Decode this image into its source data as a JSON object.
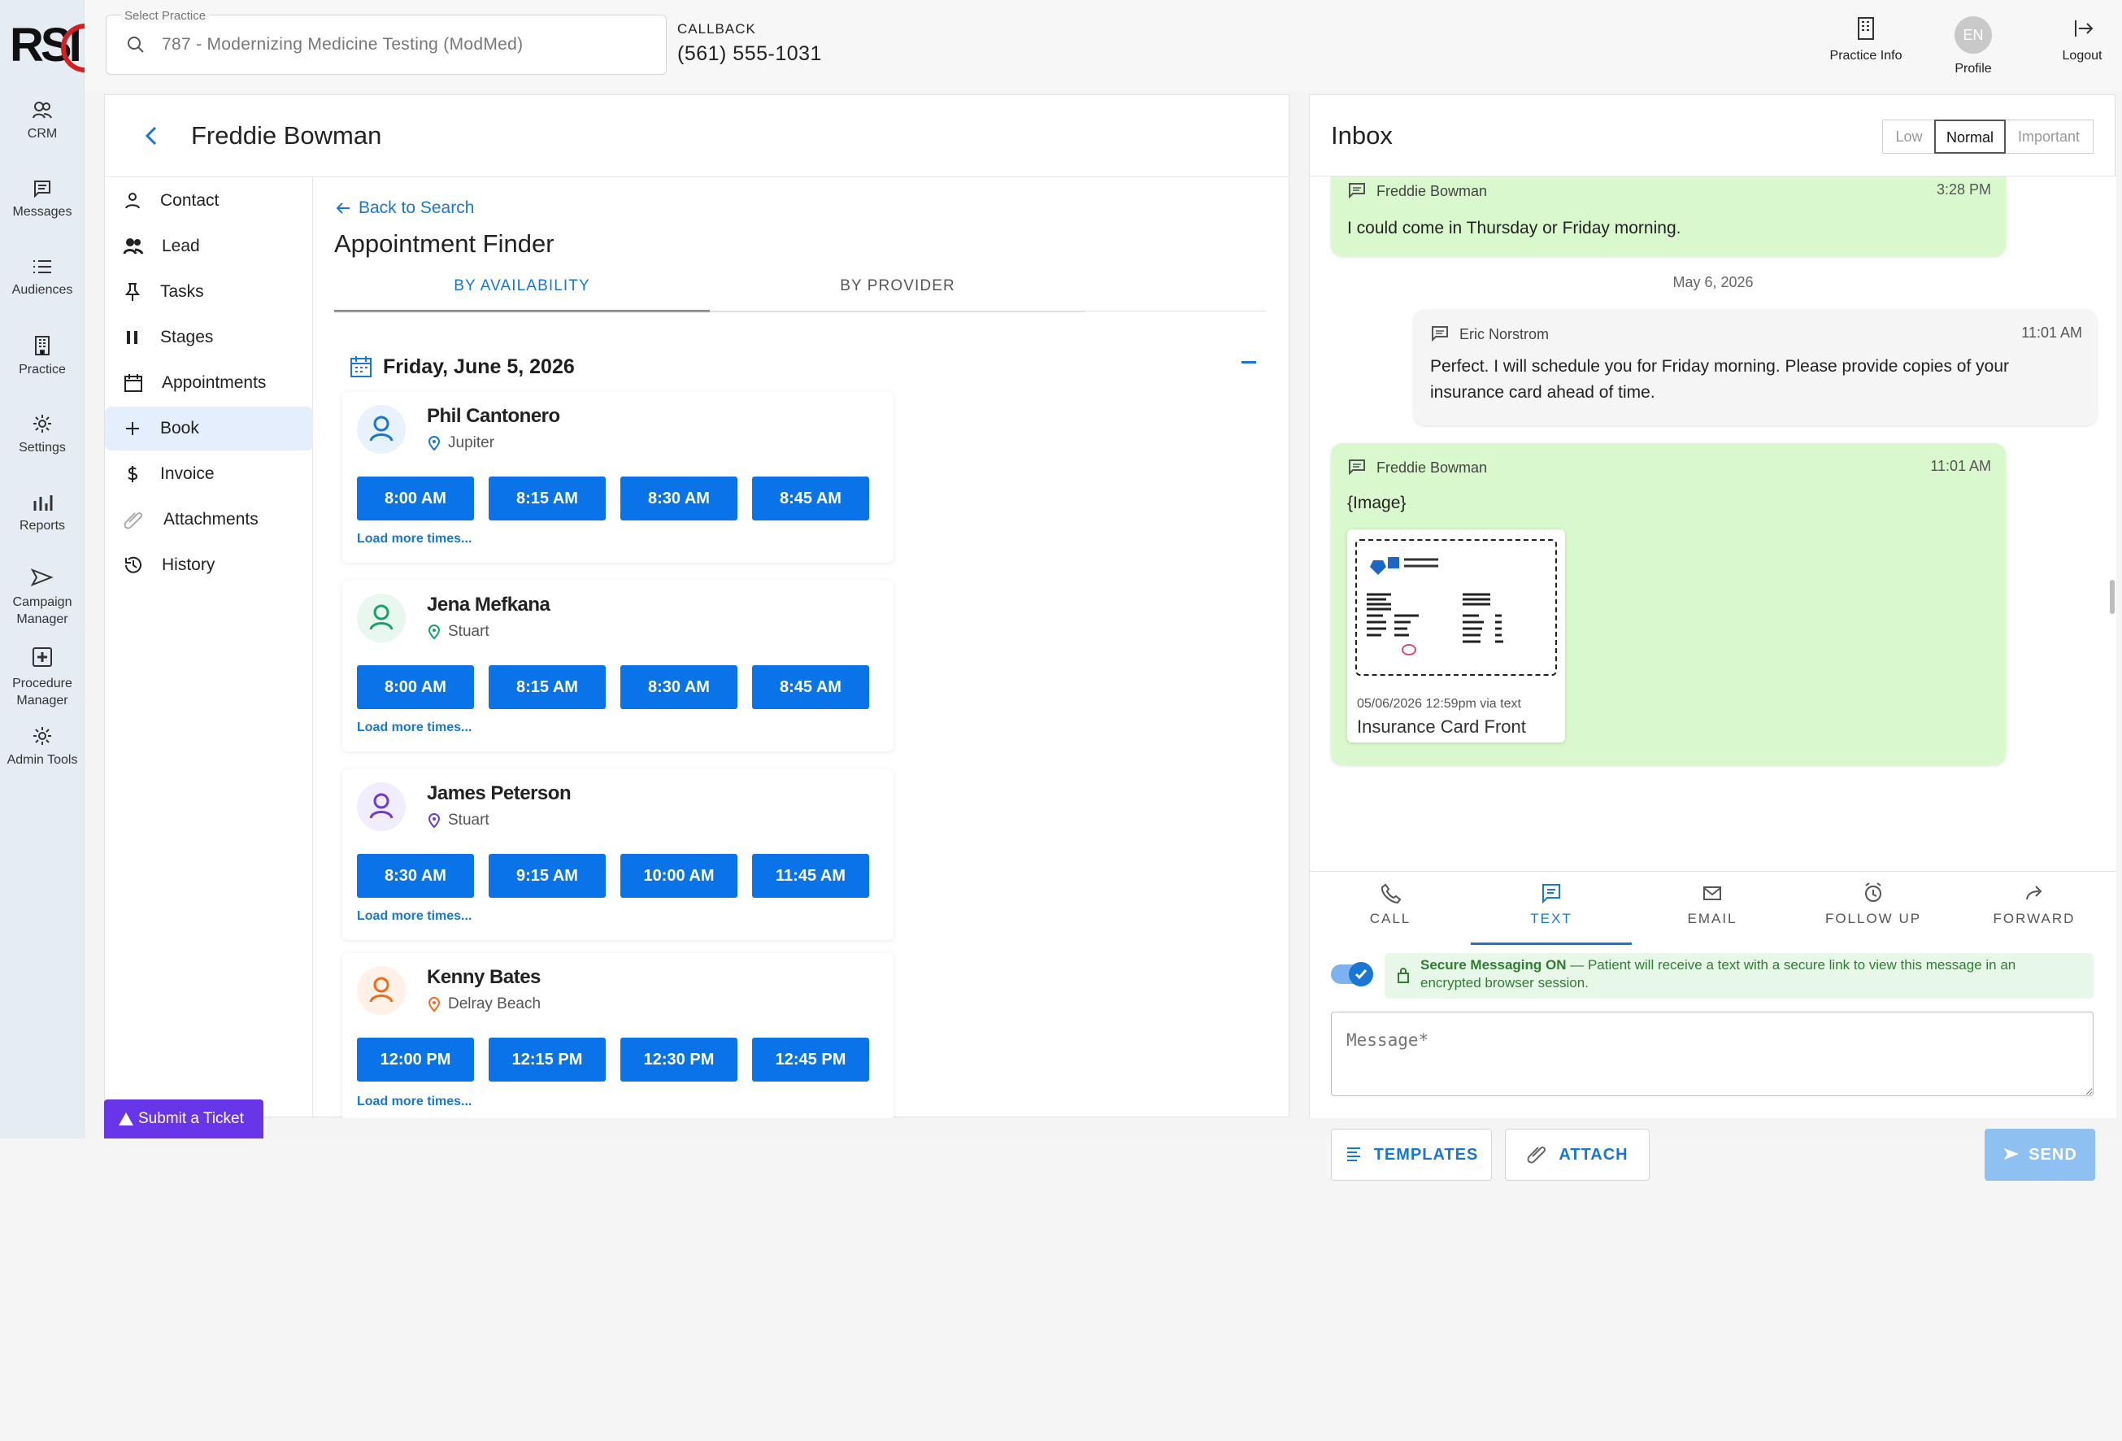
{
  "brand": {
    "logo_text": "RSI"
  },
  "rail": [
    {
      "label": "CRM",
      "icon": "users-icon"
    },
    {
      "label": "Messages",
      "icon": "message-icon"
    },
    {
      "label": "Audiences",
      "icon": "list-icon"
    },
    {
      "label": "Practice",
      "icon": "building-icon"
    },
    {
      "label": "Settings",
      "icon": "gear-icon"
    },
    {
      "label": "Reports",
      "icon": "bar-chart-icon"
    },
    {
      "label": "Campaign\nManager",
      "icon": "send-icon"
    },
    {
      "label": "Procedure\nManager",
      "icon": "plus-square-icon"
    },
    {
      "label": "Admin Tools",
      "icon": "gear-icon"
    }
  ],
  "topbar": {
    "practice_label": "Select Practice",
    "practice_value": "787 - Modernizing Medicine Testing (ModMed)",
    "callback_label": "CALLBACK",
    "callback_phone": "(561) 555-1031",
    "practice_info": "Practice Info",
    "profile": "Profile",
    "profile_initials": "EN",
    "logout": "Logout"
  },
  "patient": {
    "name": "Freddie Bowman"
  },
  "sidebar": {
    "items": [
      {
        "label": "Contact",
        "icon": "person-icon"
      },
      {
        "label": "Lead",
        "icon": "users-icon"
      },
      {
        "label": "Tasks",
        "icon": "pin-icon"
      },
      {
        "label": "Stages",
        "icon": "pause-icon"
      },
      {
        "label": "Appointments",
        "icon": "calendar-icon"
      },
      {
        "label": "Book",
        "icon": "plus-icon"
      },
      {
        "label": "Invoice",
        "icon": "dollar-icon"
      },
      {
        "label": "Attachments",
        "icon": "paperclip-icon"
      },
      {
        "label": "History",
        "icon": "history-icon"
      }
    ]
  },
  "finder": {
    "back_label": "Back to Search",
    "title": "Appointment Finder",
    "tabs": [
      "BY AVAILABILITY",
      "BY PROVIDER"
    ],
    "date": "Friday, June 5, 2026",
    "providers": [
      {
        "name": "Phil Cantonero",
        "location": "Jupiter",
        "color": "#1976d2",
        "times": [
          "8:00 AM",
          "8:15 AM",
          "8:30 AM",
          "8:45 AM"
        ],
        "load_more": "Load more times..."
      },
      {
        "name": "Jena Mefkana",
        "location": "Stuart",
        "color": "#16a36a",
        "times": [
          "8:00 AM",
          "8:15 AM",
          "8:30 AM",
          "8:45 AM"
        ],
        "load_more": "Load more times..."
      },
      {
        "name": "James Peterson",
        "location": "Stuart",
        "color": "#6b3bd2",
        "times": [
          "8:30 AM",
          "9:15 AM",
          "10:00 AM",
          "11:45 AM"
        ],
        "load_more": "Load more times..."
      },
      {
        "name": "Kenny Bates",
        "location": "Delray Beach",
        "color": "#ef6c1a",
        "times": [
          "12:00 PM",
          "12:15 PM",
          "12:30 PM",
          "12:45 PM"
        ],
        "load_more": "Load more times..."
      }
    ]
  },
  "inbox": {
    "title": "Inbox",
    "priority": [
      "Low",
      "Normal",
      "Important"
    ],
    "messages": [
      {
        "sender": "Freddie Bowman",
        "time": "3:28 PM",
        "text": "I could come in Thursday or Friday morning."
      },
      {
        "date": "May 6, 2026"
      },
      {
        "sender": "Eric Norstrom",
        "time": "11:01 AM",
        "text": "Perfect. I will schedule you for Friday morning. Please provide copies of your insurance card ahead of time."
      },
      {
        "sender": "Freddie Bowman",
        "time": "11:01 AM",
        "text": "{Image}"
      }
    ],
    "attachment": {
      "meta": "05/06/2026 12:59pm via text",
      "name": "Insurance Card Front"
    }
  },
  "composer": {
    "tabs": [
      "CALL",
      "TEXT",
      "EMAIL",
      "FOLLOW UP",
      "FORWARD"
    ],
    "secure_title": "Secure Messaging ON",
    "secure_text": " — Patient will receive a text with a secure link to view this message in an encrypted browser session.",
    "message_placeholder": "Message*",
    "templates": "TEMPLATES",
    "attach": "ATTACH",
    "send": "SEND"
  },
  "support": {
    "submit_ticket": "Submit a Ticket"
  }
}
